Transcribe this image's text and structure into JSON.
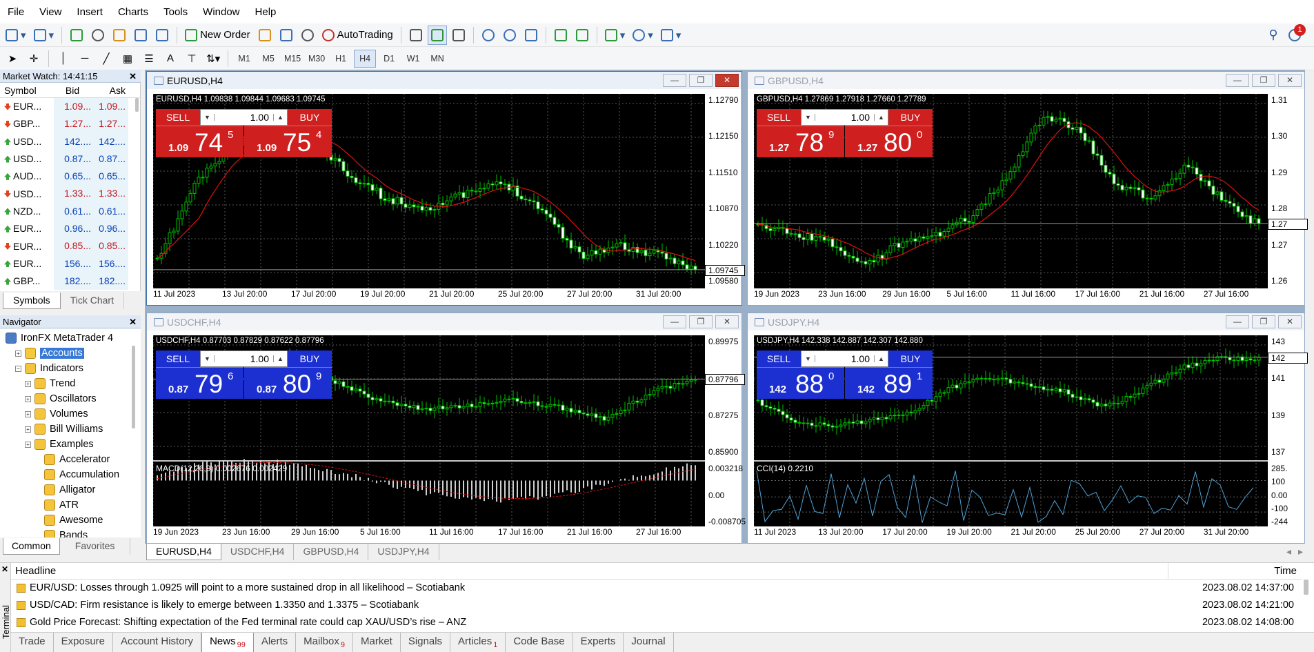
{
  "menu": [
    "File",
    "View",
    "Insert",
    "Charts",
    "Tools",
    "Window",
    "Help"
  ],
  "toolbar": {
    "new_order": "New Order",
    "autotrading": "AutoTrading",
    "timeframes": [
      "M1",
      "M5",
      "M15",
      "M30",
      "H1",
      "H4",
      "D1",
      "W1",
      "MN"
    ],
    "active_timeframe": "H4",
    "notif_count": "1"
  },
  "market_watch": {
    "title": "Market Watch: 14:41:15",
    "headers": [
      "Symbol",
      "Bid",
      "Ask"
    ],
    "rows": [
      {
        "symbol": "EUR...",
        "bid": "1.09...",
        "ask": "1.09...",
        "dir": "down"
      },
      {
        "symbol": "GBP...",
        "bid": "1.27...",
        "ask": "1.27...",
        "dir": "down"
      },
      {
        "symbol": "USD...",
        "bid": "142....",
        "ask": "142....",
        "dir": "up"
      },
      {
        "symbol": "USD...",
        "bid": "0.87...",
        "ask": "0.87...",
        "dir": "up"
      },
      {
        "symbol": "AUD...",
        "bid": "0.65...",
        "ask": "0.65...",
        "dir": "up"
      },
      {
        "symbol": "USD...",
        "bid": "1.33...",
        "ask": "1.33...",
        "dir": "down"
      },
      {
        "symbol": "NZD...",
        "bid": "0.61...",
        "ask": "0.61...",
        "dir": "up"
      },
      {
        "symbol": "EUR...",
        "bid": "0.96...",
        "ask": "0.96...",
        "dir": "up"
      },
      {
        "symbol": "EUR...",
        "bid": "0.85...",
        "ask": "0.85...",
        "dir": "down"
      },
      {
        "symbol": "EUR...",
        "bid": "156....",
        "ask": "156....",
        "dir": "up"
      },
      {
        "symbol": "GBP...",
        "bid": "182....",
        "ask": "182....",
        "dir": "up"
      }
    ],
    "tabs": [
      "Symbols",
      "Tick Chart"
    ]
  },
  "navigator": {
    "title": "Navigator",
    "items": [
      {
        "label": "IronFX MetaTrader 4",
        "level": 0,
        "exp": ""
      },
      {
        "label": "Accounts",
        "level": 1,
        "exp": "+"
      },
      {
        "label": "Indicators",
        "level": 1,
        "exp": "-"
      },
      {
        "label": "Trend",
        "level": 2,
        "exp": "+"
      },
      {
        "label": "Oscillators",
        "level": 2,
        "exp": "+"
      },
      {
        "label": "Volumes",
        "level": 2,
        "exp": "+"
      },
      {
        "label": "Bill Williams",
        "level": 2,
        "exp": "+"
      },
      {
        "label": "Examples",
        "level": 2,
        "exp": "+"
      },
      {
        "label": "Accelerator",
        "level": 3,
        "exp": ""
      },
      {
        "label": "Accumulation",
        "level": 3,
        "exp": ""
      },
      {
        "label": "Alligator",
        "level": 3,
        "exp": ""
      },
      {
        "label": "ATR",
        "level": 3,
        "exp": ""
      },
      {
        "label": "Awesome",
        "level": 3,
        "exp": ""
      },
      {
        "label": "Bands",
        "level": 3,
        "exp": ""
      }
    ],
    "tabs": [
      "Common",
      "Favorites"
    ]
  },
  "charts": [
    {
      "title": "EURUSD,H4",
      "info": "EURUSD,H4  1.09838 1.09844 1.09683 1.09745",
      "color": "red",
      "lot": "1.00",
      "sell_small": "1.09",
      "sell_big": "74",
      "sell_sup": "5",
      "buy_small": "1.09",
      "buy_big": "75",
      "buy_sup": "4",
      "prices": [
        "1.12790",
        "1.12150",
        "1.11510",
        "1.10870",
        "1.10220",
        "1.09580"
      ],
      "current": "1.09745",
      "dates": [
        "11 Jul 2023",
        "13 Jul 20:00",
        "17 Jul 20:00",
        "19 Jul 20:00",
        "21 Jul 20:00",
        "25 Jul 20:00",
        "27 Jul 20:00",
        "31 Jul 20:00"
      ],
      "sub": null
    },
    {
      "title": "GBPUSD,H4",
      "info": "GBPUSD,H4  1.27869 1.27918 1.27660 1.27789",
      "color": "red",
      "lot": "1.00",
      "sell_small": "1.27",
      "sell_big": "78",
      "sell_sup": "9",
      "buy_small": "1.27",
      "buy_big": "80",
      "buy_sup": "0",
      "prices": [
        "1.31",
        "1.30",
        "1.29",
        "1.28",
        "1.27",
        "1.26"
      ],
      "current": "1.27",
      "dates": [
        "19 Jun 2023",
        "23 Jun 16:00",
        "29 Jun 16:00",
        "5 Jul 16:00",
        "11 Jul 16:00",
        "17 Jul 16:00",
        "21 Jul 16:00",
        "27 Jul 16:00"
      ],
      "sub": null
    },
    {
      "title": "USDCHF,H4",
      "info": "USDCHF,H4  0.87703 0.87829 0.87622 0.87796",
      "color": "blue",
      "lot": "1.00",
      "sell_small": "0.87",
      "sell_big": "79",
      "sell_sup": "6",
      "buy_small": "0.87",
      "buy_big": "80",
      "buy_sup": "9",
      "prices": [
        "0.89975",
        "0.88625",
        "0.87275",
        "0.85900"
      ],
      "current": "0.87796",
      "dates": [
        "19 Jun 2023",
        "23 Jun 16:00",
        "29 Jun 16:00",
        "5 Jul 16:00",
        "11 Jul 16:00",
        "17 Jul 16:00",
        "21 Jul 16:00",
        "27 Jul 16:00"
      ],
      "sub": {
        "label": "MACD(12,26,9) 0.002676 0.002429",
        "levels": [
          "0.003218",
          "0.00",
          "-0.008705"
        ]
      }
    },
    {
      "title": "USDJPY,H4",
      "info": "USDJPY,H4  142.338 142.887 142.307 142.880",
      "color": "blue",
      "lot": "1.00",
      "sell_small": "142",
      "sell_big": "88",
      "sell_sup": "0",
      "buy_small": "142",
      "buy_big": "89",
      "buy_sup": "1",
      "prices": [
        "143",
        "141",
        "139",
        "137"
      ],
      "current": "142",
      "dates": [
        "11 Jul 2023",
        "13 Jul 20:00",
        "17 Jul 20:00",
        "19 Jul 20:00",
        "21 Jul 20:00",
        "25 Jul 20:00",
        "27 Jul 20:00",
        "31 Jul 20:00"
      ],
      "sub": {
        "label": "CCI(14) 0.2210",
        "levels": [
          "285.",
          "100",
          "0.00",
          "-100",
          "-244"
        ]
      }
    }
  ],
  "chart_tabs": [
    "EURUSD,H4",
    "USDCHF,H4",
    "GBPUSD,H4",
    "USDJPY,H4"
  ],
  "common": {
    "sell": "SELL",
    "buy": "BUY"
  },
  "terminal": {
    "side_label": "Terminal",
    "headline_col": "Headline",
    "time_col": "Time",
    "news": [
      {
        "headline": "EUR/USD: Losses through 1.0925 will point to a more sustained drop in all likelihood – Scotiabank",
        "time": "2023.08.02 14:37:00"
      },
      {
        "headline": "USD/CAD: Firm resistance is likely to emerge between 1.3350 and 1.3375 – Scotiabank",
        "time": "2023.08.02 14:21:00"
      },
      {
        "headline": "Gold Price Forecast: Shifting expectation of the Fed terminal rate could cap XAU/USD’s rise – ANZ",
        "time": "2023.08.02 14:08:00"
      }
    ],
    "tabs": [
      {
        "label": "Trade",
        "badge": ""
      },
      {
        "label": "Exposure",
        "badge": ""
      },
      {
        "label": "Account History",
        "badge": ""
      },
      {
        "label": "News",
        "badge": "99"
      },
      {
        "label": "Alerts",
        "badge": ""
      },
      {
        "label": "Mailbox",
        "badge": "9"
      },
      {
        "label": "Market",
        "badge": ""
      },
      {
        "label": "Signals",
        "badge": ""
      },
      {
        "label": "Articles",
        "badge": "1"
      },
      {
        "label": "Code Base",
        "badge": ""
      },
      {
        "label": "Experts",
        "badge": ""
      },
      {
        "label": "Journal",
        "badge": ""
      }
    ],
    "active_tab": "News"
  }
}
